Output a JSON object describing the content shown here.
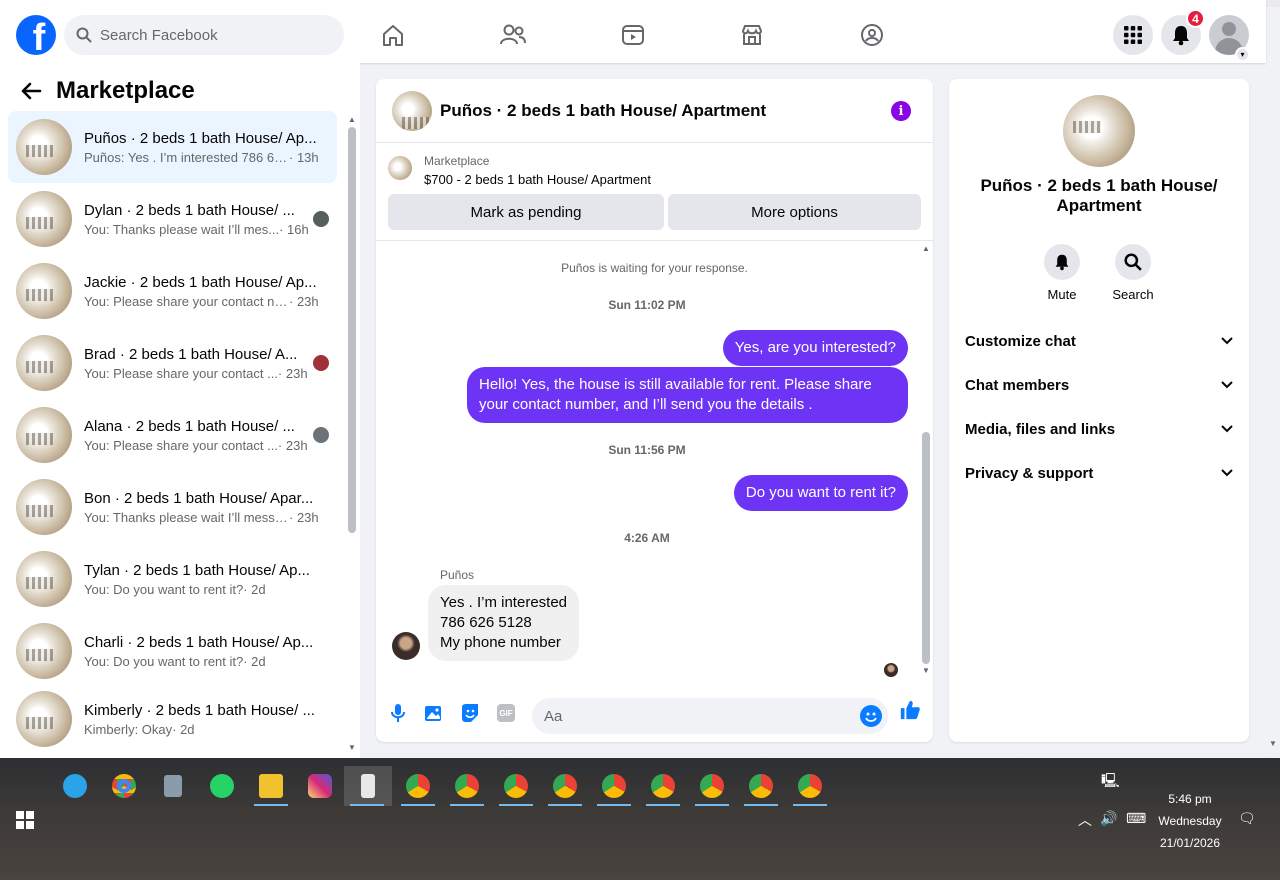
{
  "topbar": {
    "logo": "f",
    "search_placeholder": "Search Facebook",
    "nav_icons": [
      "home-icon",
      "friends-icon",
      "watch-icon",
      "marketplace-icon",
      "groups-icon"
    ],
    "notification_count": "4"
  },
  "left": {
    "title": "Marketplace",
    "conversations": [
      {
        "title": "Puños · 2 beds 1 bath House/ Ap...",
        "msg": "Puños: Yes . I’m interested 786 62...",
        "time": "· 13h",
        "active": true
      },
      {
        "title": "Dylan · 2 beds 1 bath House/ ...",
        "msg": "You: Thanks please wait I’ll mes...",
        "time": "· 16h"
      },
      {
        "title": "Jackie · 2 beds 1 bath House/ Ap...",
        "msg": "You: Please share your contact nu...",
        "time": "· 23h"
      },
      {
        "title": "Brad · 2 beds 1 bath House/ A...",
        "msg": "You: Please share your contact ...",
        "time": "· 23h"
      },
      {
        "title": "Alana · 2 beds 1 bath House/ ...",
        "msg": "You: Please share your contact ...",
        "time": "· 23h"
      },
      {
        "title": "Bon · 2 beds 1 bath House/ Apar...",
        "msg": "You: Thanks please wait I’ll messa...",
        "time": "· 23h"
      },
      {
        "title": "Tylan · 2 beds 1 bath House/ Ap...",
        "msg": "You: Do you want to rent it?",
        "time": "· 2d"
      },
      {
        "title": "Charli · 2 beds 1 bath House/ Ap...",
        "msg": "You: Do you want to rent it?",
        "time": "· 2d"
      },
      {
        "title": "Kimberly · 2 beds 1 bath House/ ...",
        "msg": "Kimberly: Okay",
        "time": "· 2d"
      }
    ]
  },
  "chat": {
    "title": "Puños · 2 beds 1 bath House/ Apartment",
    "marketplace_label": "Marketplace",
    "listing": "$700 - 2 beds 1 bath House/ Apartment",
    "pending_label": "Mark as pending",
    "more_label": "More options",
    "waiting": "Puños is waiting for your response.",
    "time1": "Sun 11:02 PM",
    "out1": "Yes, are you interested?",
    "out2": "Hello! Yes, the house is still available for rent. Please share your contact number, and I’ll send you the details .",
    "time2": "Sun 11:56 PM",
    "out3": "Do you want to rent it?",
    "time3": "4:26 AM",
    "in_name": "Puños",
    "in1_line1": "Yes . I’m interested",
    "in1_line2": "786 626 5128",
    "in1_line3": "My phone number",
    "composer_placeholder": "Aa",
    "gif_label": "GIF"
  },
  "right": {
    "title": "Puños · 2 beds 1 bath House/ Apartment",
    "mute_label": "Mute",
    "search_label": "Search",
    "rows": [
      "Customize chat",
      "Chat members",
      "Media, files and links",
      "Privacy & support"
    ]
  },
  "taskbar": {
    "time": "5:46 pm",
    "day": "Wednesday",
    "date": "21/01/2026"
  },
  "colors": {
    "accent": "#0866ff",
    "bubble_out": "#6e34f5",
    "badge": "#e41e3f",
    "info": "#8a05e4"
  }
}
